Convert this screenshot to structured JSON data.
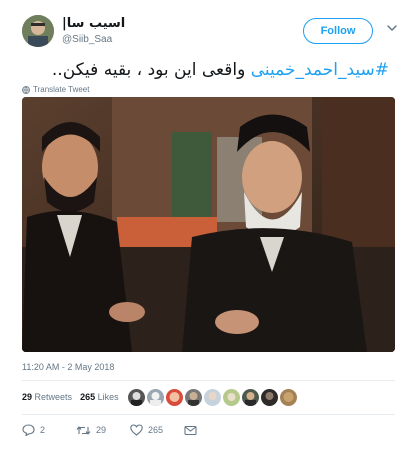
{
  "user": {
    "display_name": "اسیب سا|",
    "handle": "@Siib_Saa"
  },
  "follow": {
    "label": "Follow"
  },
  "tweet": {
    "hashtag": "#سید_احمد_خمینی",
    "text": " واقعی این بود ، بقیه فیکن..",
    "translate_label": "Translate Tweet",
    "timestamp": "11:20 AM - 2 May 2018"
  },
  "stats": {
    "retweets_count": "29",
    "retweets_label": "Retweets",
    "likes_count": "265",
    "likes_label": "Likes"
  },
  "actions": {
    "reply_count": "2",
    "retweet_count": "29",
    "like_count": "265"
  },
  "colors": {
    "accent": "#1da1f2",
    "text": "#14171a",
    "muted": "#657786",
    "divider": "#e6ecf0"
  },
  "icons": [
    "chevron-down-icon",
    "globe-icon",
    "reply-icon",
    "retweet-icon",
    "heart-icon",
    "message-icon"
  ]
}
